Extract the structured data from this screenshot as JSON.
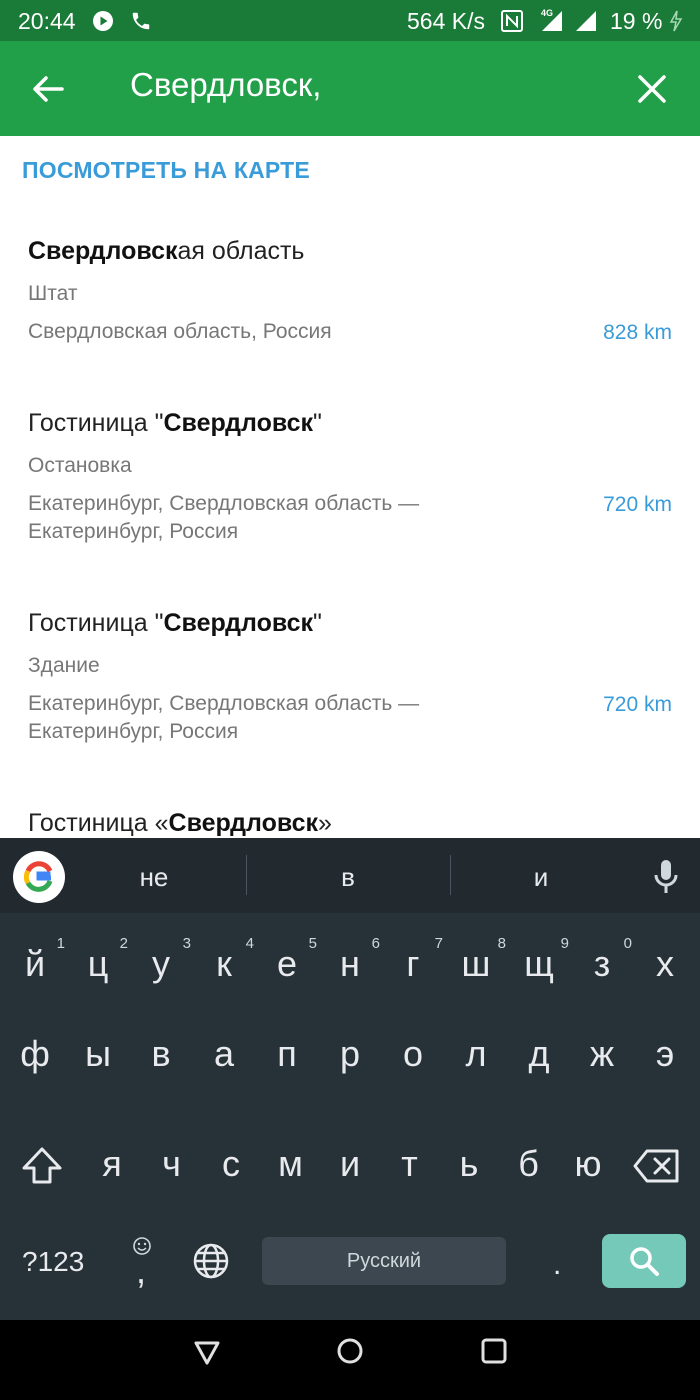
{
  "status_bar": {
    "time": "20:44",
    "speed": "564 K/s",
    "network": "4G",
    "battery": "19 %"
  },
  "app_bar": {
    "query": "Свердловск,"
  },
  "map_link": "ПОСМОТРЕТЬ НА КАРТЕ",
  "results": [
    {
      "title_pre": "",
      "title_bold": "Свердловск",
      "title_post": "ая область",
      "type": "Штат",
      "address": "Свердловская область, Россия",
      "distance": "828 km"
    },
    {
      "title_pre": "Гостиница \"",
      "title_bold": "Свердловск",
      "title_post": "\"",
      "type": "Остановка",
      "address": "Екатеринбург, Свердловская область — Екатеринбург, Россия",
      "distance": "720 km"
    },
    {
      "title_pre": "Гостиница \"",
      "title_bold": "Свердловск",
      "title_post": "\"",
      "type": "Здание",
      "address": "Екатеринбург, Свердловская область — Екатеринбург, Россия",
      "distance": "720 km"
    },
    {
      "title_pre": "Гостиница «",
      "title_bold": "Свердловск",
      "title_post": "»",
      "type": "",
      "address": "",
      "distance": ""
    }
  ],
  "keyboard": {
    "suggestions": [
      "не",
      "в",
      "и"
    ],
    "row1": [
      {
        "k": "й",
        "n": "1"
      },
      {
        "k": "ц",
        "n": "2"
      },
      {
        "k": "у",
        "n": "3"
      },
      {
        "k": "к",
        "n": "4"
      },
      {
        "k": "е",
        "n": "5"
      },
      {
        "k": "н",
        "n": "6"
      },
      {
        "k": "г",
        "n": "7"
      },
      {
        "k": "ш",
        "n": "8"
      },
      {
        "k": "щ",
        "n": "9"
      },
      {
        "k": "з",
        "n": "0"
      },
      {
        "k": "х",
        "n": ""
      }
    ],
    "row2": [
      "ф",
      "ы",
      "в",
      "а",
      "п",
      "р",
      "о",
      "л",
      "д",
      "ж",
      "э"
    ],
    "row3": [
      "я",
      "ч",
      "с",
      "м",
      "и",
      "т",
      "ь",
      "б",
      "ю"
    ],
    "symbols_label": "?123",
    "comma": ",",
    "period": ".",
    "space_label": "Русский"
  }
}
